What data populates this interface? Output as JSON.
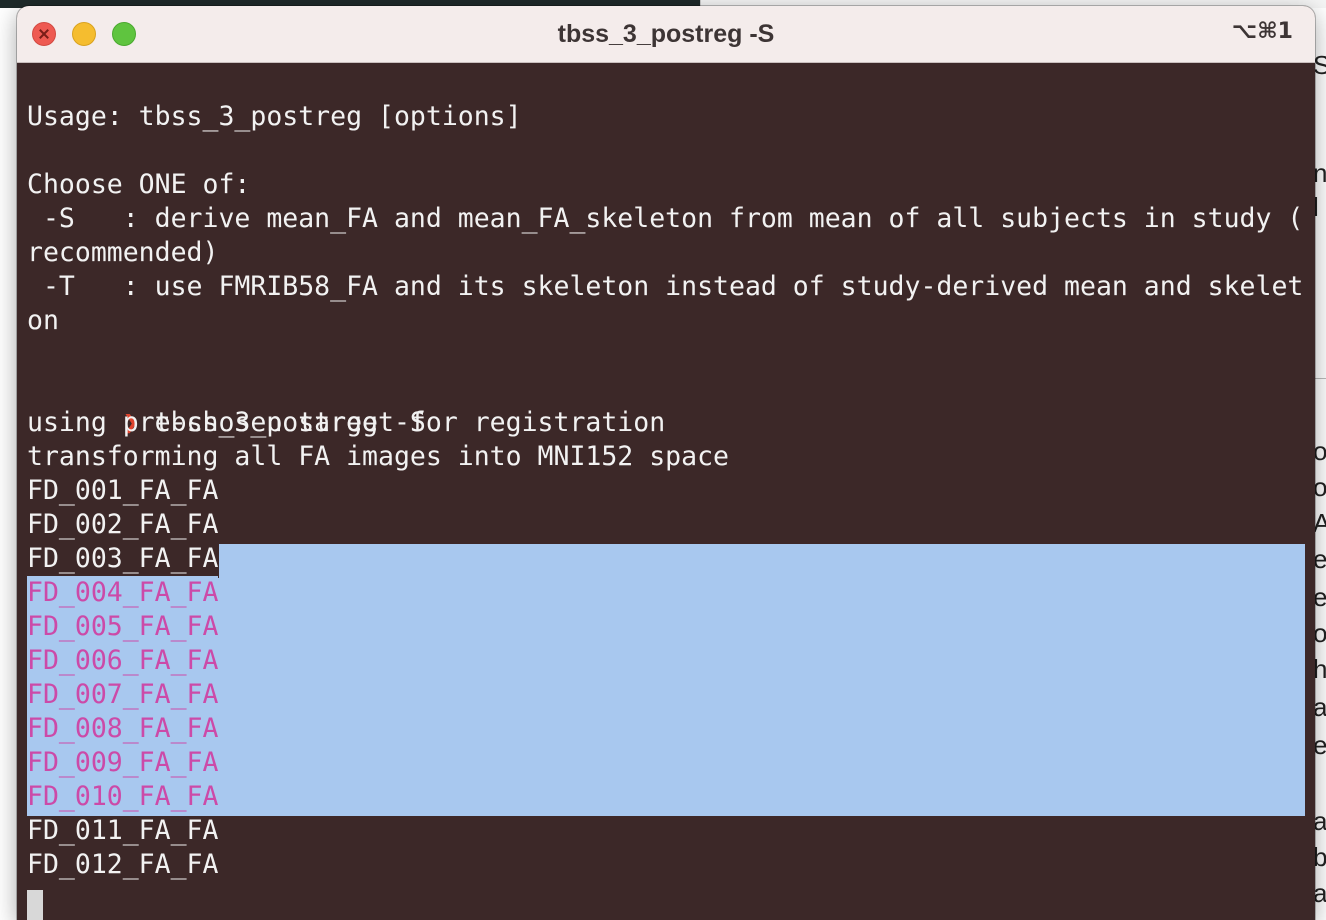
{
  "window": {
    "title": "tbss_3_postreg -S",
    "shortcut": "⌥⌘1"
  },
  "terminal": {
    "usage": "Usage: tbss_3_postreg [options]",
    "choose": "Choose ONE of:",
    "option_s_line1": " -S   : derive mean_FA and mean_FA_skeleton from mean of all subjects in study (",
    "option_s_line2": "recommended)",
    "option_t_line1": " -T   : use FMRIB58_FA and its skeleton instead of study-derived mean and skelet",
    "option_t_line2": "on",
    "prompt_symbol": "❯",
    "command": " tbss_3_postreg -S",
    "output": [
      "using pre-chosen target for registration",
      "transforming all FA images into MNI152 space",
      "FD_001_FA_FA",
      "FD_002_FA_FA",
      "FD_003_FA_FA",
      "FD_004_FA_FA",
      "FD_005_FA_FA",
      "FD_006_FA_FA",
      "FD_007_FA_FA",
      "FD_008_FA_FA",
      "FD_009_FA_FA",
      "FD_010_FA_FA",
      "FD_011_FA_FA",
      "FD_012_FA_FA"
    ]
  },
  "colors": {
    "terminal_bg": "#3c2828",
    "terminal_fg": "#f2f2f2",
    "selection_bg": "#a8c8ef",
    "selection_fg": "#cc4aa8",
    "prompt": "#e0442e",
    "title_bar": "#f4eceb"
  },
  "background_window": {
    "text_fragments": [
      "S",
      "n",
      "l",
      "o",
      "o",
      "A",
      "e",
      "e",
      "o",
      "h",
      "a",
      "e",
      "a",
      "b",
      "a"
    ]
  }
}
